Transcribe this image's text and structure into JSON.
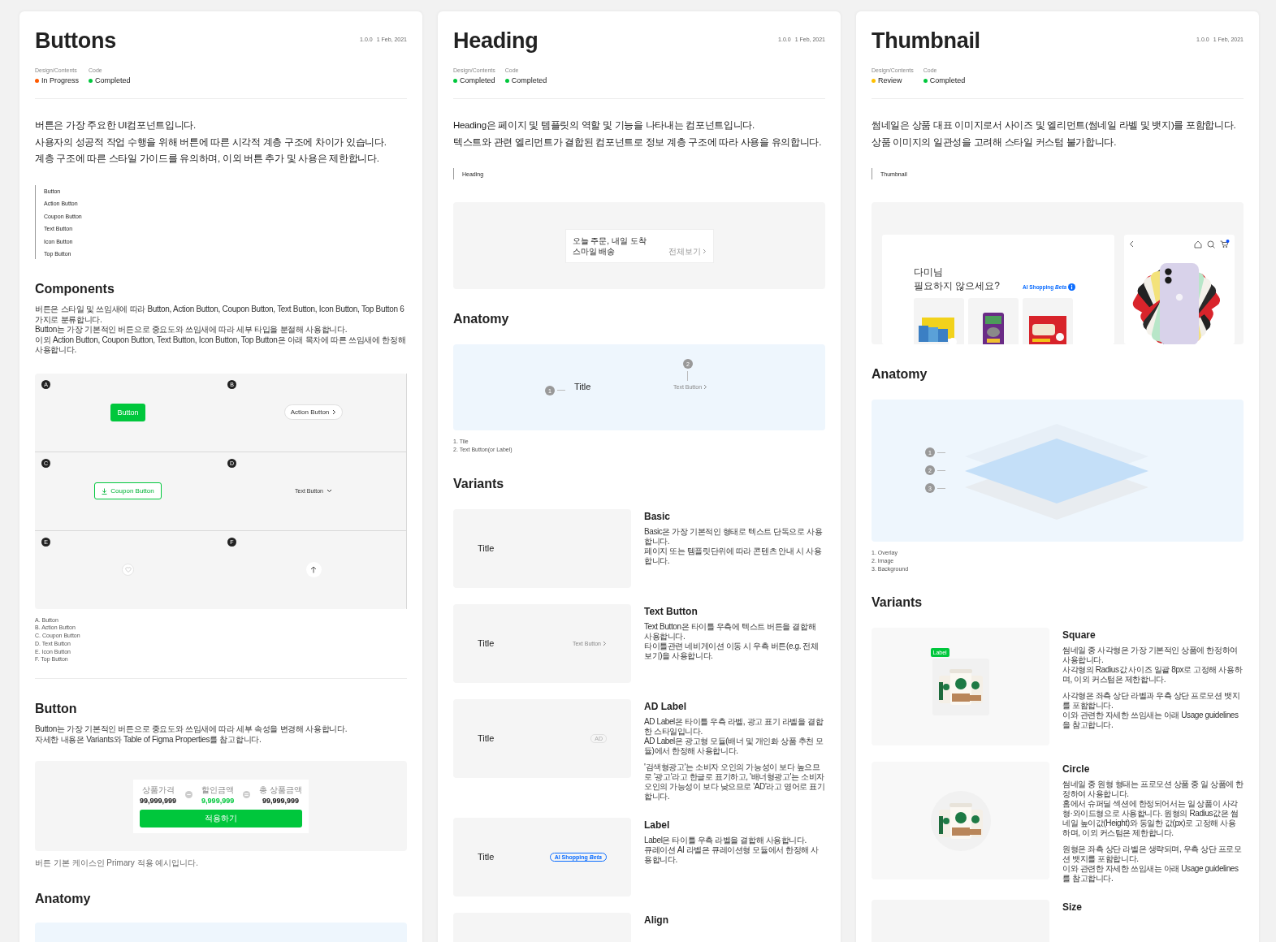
{
  "columns": [
    {
      "title": "Buttons",
      "version": "1.0.0",
      "date": "1 Feb, 2021",
      "statuses": [
        {
          "label": "Design/Contents",
          "value": "In Progress",
          "color": "#ff5a00"
        },
        {
          "label": "Code",
          "value": "Completed",
          "color": "#00c73c"
        }
      ],
      "intro": [
        "버튼은 가장 주요한 UI컴포넌트입니다.",
        "사용자의 성공적 작업 수행을 위해 버튼에 따른 시각적 계층 구조에 차이가 있습니다.",
        "계층 구조에 따른 스타일 가이드를 유의하며, 이외 버튼 추가 및 사용은 제한합니다."
      ],
      "toc": [
        "Button",
        "Action Button",
        "Coupon Button",
        "Text Button",
        "Icon Button",
        "Top Button"
      ],
      "blocks": [
        {
          "kind": "heading",
          "text": "Components"
        },
        {
          "kind": "paragraph",
          "lines": [
            "버튼은 스타일 및 쓰임새에 따라 Button, Action Button, Coupon Button, Text Button, Icon Button, Top Button 6가지로 분류합니다.",
            "Button는 가장 기본적인 버튼으로 중요도와 쓰임새에 따라 세부 타입을 분절해 사용합니다.",
            "이외 Action Button, Coupon Button, Text Button, Icon Button, Top Button은  아래 목차에 따른 쓰임새에 한정해 사용합니다."
          ]
        },
        {
          "kind": "button-grid",
          "cells": [
            {
              "letter": "A",
              "kind": "primary",
              "label": "Button"
            },
            {
              "letter": "B",
              "kind": "action",
              "label": "Action Button"
            },
            {
              "letter": "C",
              "kind": "coupon",
              "label": "Coupon Button"
            },
            {
              "letter": "D",
              "kind": "text",
              "label": "Text Button"
            },
            {
              "letter": "E",
              "kind": "icon"
            },
            {
              "letter": "F",
              "kind": "top"
            }
          ]
        },
        {
          "kind": "legend",
          "lines": [
            "A. Button",
            "B. Action Button",
            "C. Coupon Button",
            "D. Text Button",
            "E. Icon Button",
            "F. Top Button"
          ]
        },
        {
          "kind": "divider"
        },
        {
          "kind": "heading",
          "text": "Button"
        },
        {
          "kind": "paragraph",
          "lines": [
            "Button는 가장 기본적인 버튼으로 중요도와 쓰임새에 따라 세부 속성을 변경해 사용합니다.",
            "자세한 내용은 Variants와 Table of Figma Properties를 참고합니다."
          ]
        },
        {
          "kind": "price-demo",
          "items": [
            {
              "label": "상품가격",
              "value": "99,999,999",
              "highlight": false
            },
            {
              "label": "할인금액",
              "value": "9,999,999",
              "highlight": true
            },
            {
              "label": "총 상품금액",
              "value": "99,999,999",
              "highlight": false
            }
          ],
          "button": "적용하기"
        },
        {
          "kind": "caption",
          "text": "버튼 기본 케이스인 Primary 적용 예시입니다."
        },
        {
          "kind": "heading",
          "text": "Anatomy"
        },
        {
          "kind": "panel"
        }
      ]
    },
    {
      "title": "Heading",
      "version": "1.0.0",
      "date": "1 Feb, 2021",
      "statuses": [
        {
          "label": "Design/Contents",
          "value": "Completed",
          "color": "#00c73c"
        },
        {
          "label": "Code",
          "value": "Completed",
          "color": "#00c73c"
        }
      ],
      "intro": [
        "Heading은 페이지 및 템플릿의 역할 및 기능을 나타내는 컴포넌트입니다.",
        "텍스트와 관련 엘리먼트가 결합된 컴포넌트로 정보 계층 구조에 따라 사용을 유의합니다."
      ],
      "toc": [
        "Heading"
      ],
      "blocks": [
        {
          "kind": "heading-preview",
          "lines": [
            "오늘 주문, 내일 도착",
            "스마일 배송"
          ],
          "link": "전체보기"
        },
        {
          "kind": "heading",
          "text": "Anatomy"
        },
        {
          "kind": "heading-anatomy",
          "title": "Title",
          "link": "Text Button",
          "markers": [
            "1",
            "2"
          ]
        },
        {
          "kind": "legend",
          "lines": [
            "1. Tile",
            "2. Text Button(or Label)"
          ]
        },
        {
          "kind": "heading",
          "text": "Variants"
        },
        {
          "kind": "variant",
          "name": "Basic",
          "preview": {
            "kind": "basic",
            "title": "Title"
          },
          "paragraphs": [
            [
              "Basic은 가장 기본적인 형태로 텍스트 단독으로 사용합니다.",
              "페이지 또는 템플릿단위에 따라 콘텐츠 안내 시 사용합니다."
            ]
          ]
        },
        {
          "kind": "variant",
          "name": "Text Button",
          "preview": {
            "kind": "text-button",
            "title": "Title",
            "extra": "Text Button"
          },
          "paragraphs": [
            [
              "Text Button은 타이틀 우측에 텍스트 버튼을 결합해 사용합니다.",
              "타이틀관련 네비게이션 이동 시 우측 버튼(e.g. 전체보기)을 사용합니다."
            ]
          ]
        },
        {
          "kind": "variant",
          "name": "AD Label",
          "preview": {
            "kind": "ad-label",
            "title": "Title",
            "extra": "AD"
          },
          "paragraphs": [
            [
              "AD Label은 타이틀 우측 라벨, 광고 표기 라벨을 결합한 스타일입니다.",
              "AD Label은 광고형 모듈(배너 및 개인화 상품 추천 모듈)에서 한정해 사용합니다."
            ],
            [
              "'검색형광고'는 소비자 오인의 가능성이 보다 높으므로 '광고'라고 한글로 표기하고, '배너형광고'는 소비자 오인의 가능성이 보다 낮으므로 'AD'라고 영어로 표기합니다."
            ]
          ]
        },
        {
          "kind": "variant",
          "name": "Label",
          "preview": {
            "kind": "label",
            "title": "Title",
            "extra": "AI Shopping *Beta*"
          },
          "paragraphs": [
            [
              "Label은 타이틀 우측 라벨을 결합해 사용합니다.",
              "큐레이션 AI 라벨은 큐레이션형 모듈에서 한정해 사용합니다."
            ]
          ]
        },
        {
          "kind": "variant",
          "name": "Align"
        }
      ]
    },
    {
      "title": "Thumbnail",
      "version": "1.0.0",
      "date": "1 Feb, 2021",
      "statuses": [
        {
          "label": "Design/Contents",
          "value": "Review",
          "color": "#ffc000"
        },
        {
          "label": "Code",
          "value": "Completed",
          "color": "#00c73c"
        }
      ],
      "intro": [
        "썸네일은 상품 대표 이미지로서 사이즈 및 엘리먼트(썸네일 라벨 및 뱃지)를 포함합니다.",
        "상품 이미지의 일관성을 고려해 스타일 커스텀 불가합니다."
      ],
      "toc": [
        "Thumbnail"
      ],
      "blocks": [
        {
          "kind": "thumb-preview",
          "lines": [
            "다미님",
            "필요하지 않으세요?"
          ],
          "tag": "AI Shopping *Beta*"
        },
        {
          "kind": "heading",
          "text": "Anatomy"
        },
        {
          "kind": "layers-anatomy",
          "markers": [
            "1",
            "2",
            "3"
          ]
        },
        {
          "kind": "legend",
          "lines": [
            "1. Overlay",
            "2. Image",
            "3. Background"
          ]
        },
        {
          "kind": "heading",
          "text": "Variants"
        },
        {
          "kind": "variant",
          "name": "Square",
          "preview": {
            "kind": "thumb-square",
            "extra": "Label"
          },
          "paragraphs": [
            [
              "썸네일 중 사각형은 가장 기본적인 상품에 한정하여 사용합니다.",
              "사각형의 Radius값 사이즈 일괄 8px로 고정해 사용하며, 이외 커스텀은 제한합니다."
            ],
            [
              "사각형은 좌측 상단 라벨과 우측 상단 프로모션 뱃지를 포함합니다.",
              "이와 관련한 자세한 쓰임새는 아래 Usage guidelines을 참고합니다."
            ]
          ]
        },
        {
          "kind": "variant",
          "name": "Circle",
          "preview": {
            "kind": "thumb-circle"
          },
          "paragraphs": [
            [
              "썸네일 중 원형 형태는 프로모션 상품 중 일 상품에 한정하여 사용합니다.",
              "홈에서 슈퍼딜 섹션에 한정되어서는 일 상품이 사각형·와이드형으로 사용합니다. 원형의 Radius값은 썸네일 높이값(Height)와 동일한 값(px)로 고정해 사용하며, 이외 커스텀은 제한합니다."
            ],
            [
              "원형은 좌측 상단 라벨은 생략되며, 우측 상단 프로모션 뱃지를 포함합니다.",
              "이와 관련한 자세한 쓰임새는 아래 Usage guidelines를 참고합니다."
            ]
          ]
        },
        {
          "kind": "variant",
          "name": "Size"
        }
      ]
    }
  ]
}
